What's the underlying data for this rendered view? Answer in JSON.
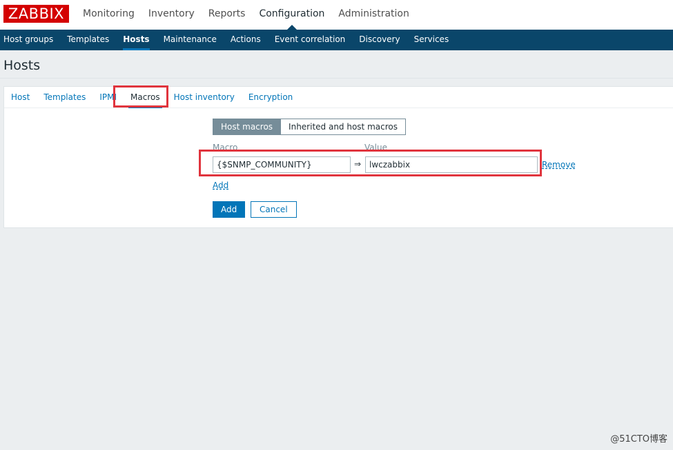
{
  "logo": "ZABBIX",
  "top_menu": [
    "Monitoring",
    "Inventory",
    "Reports",
    "Configuration",
    "Administration"
  ],
  "sub_menu": [
    "Host groups",
    "Templates",
    "Hosts",
    "Maintenance",
    "Actions",
    "Event correlation",
    "Discovery",
    "Services"
  ],
  "page_title": "Hosts",
  "tabs": [
    "Host",
    "Templates",
    "IPMI",
    "Macros",
    "Host inventory",
    "Encryption"
  ],
  "macro_view": {
    "host_macros": "Host macros",
    "inherited": "Inherited and host macros"
  },
  "columns": {
    "macro": "Macro",
    "value": "Value"
  },
  "macro_row": {
    "macro": "{$SNMP_COMMUNITY}",
    "arrow": "⇒",
    "value": "lwczabbix",
    "remove": "Remove"
  },
  "add_link": "Add",
  "buttons": {
    "add": "Add",
    "cancel": "Cancel"
  },
  "watermark": "@51CTO博客",
  "colors": {
    "brand": "#d40000",
    "nav": "#0a466a",
    "link": "#0275b8",
    "highlight": "#e0343d"
  }
}
